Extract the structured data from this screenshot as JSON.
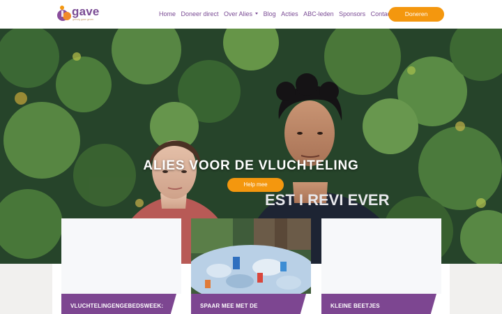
{
  "brand": {
    "name": "gave",
    "tagline": "gelovig gaan geven",
    "colors": {
      "purple": "#7a4b94",
      "orange": "#f4970e",
      "card_purple": "#7d4691"
    }
  },
  "nav": {
    "items": [
      "Home",
      "Doneer direct",
      "Over Alies",
      "Blog",
      "Acties",
      "ABC-leden",
      "Sponsors",
      "Contact"
    ],
    "dropdown_item": "Over Alies",
    "cta": "Doneren"
  },
  "hero": {
    "title": "ALIES VOOR DE VLUCHTELING",
    "button": "Help mee",
    "shirt_text": "EST I REVI EVER"
  },
  "cards": [
    {
      "title": "VLUCHTELINGENGEBEDSWEEK:",
      "image": "blank"
    },
    {
      "title": "SPAAR MEE MET DE",
      "image": "plastic-bottles"
    },
    {
      "title": "KLEINE BEETJES",
      "image": "blank"
    }
  ]
}
